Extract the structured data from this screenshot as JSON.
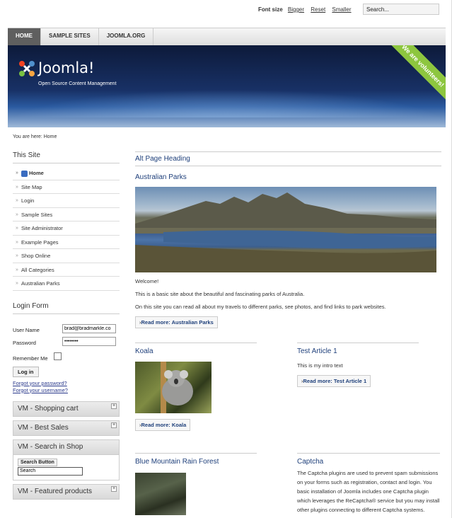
{
  "top": {
    "font_size_label": "Font size",
    "bigger": "Bigger",
    "reset": "Reset",
    "smaller": "Smaller",
    "search_value": "Search..."
  },
  "nav": {
    "items": [
      {
        "label": "HOME",
        "active": true
      },
      {
        "label": "SAMPLE SITES",
        "active": false
      },
      {
        "label": "JOOMLA.ORG",
        "active": false
      }
    ]
  },
  "header": {
    "logo_text": "Joomla!",
    "tagline": "Open Source Content Management",
    "banner": "We are volunteers!"
  },
  "breadcrumb": "You are here: Home",
  "sidebar": {
    "this_site_title": "This Site",
    "menu": [
      {
        "label": "Home"
      },
      {
        "label": "Site Map"
      },
      {
        "label": "Login"
      },
      {
        "label": "Sample Sites"
      },
      {
        "label": "Site Administrator"
      },
      {
        "label": "Example Pages"
      },
      {
        "label": "Shop Online"
      },
      {
        "label": "All Categories"
      },
      {
        "label": "Australian Parks"
      }
    ],
    "login": {
      "title": "Login Form",
      "user_label": "User Name",
      "user_value": "brad@bradmarkle.co",
      "password_label": "Password",
      "password_value": "••••••••",
      "remember_label": "Remember Me",
      "login_button": "Log in",
      "forgot_password": "Forgot your password?",
      "forgot_username": "Forgot your username?"
    },
    "vm": {
      "cart": "VM - Shopping cart",
      "best": "VM - Best Sales",
      "search": "VM - Search in Shop",
      "search_button": "Search Button",
      "search_value": "Search",
      "featured": "VM - Featured products",
      "plus": "+"
    }
  },
  "main": {
    "alt_heading": "Alt Page Heading",
    "article_title": "Australian Parks",
    "p1": "Welcome!",
    "p2": "This is a basic site about the beautiful and fascinating parks of Australia.",
    "p3": "On this site you can read all about my travels to different parks, see photos, and find links to park websites.",
    "readmore_parks": "Read more: Australian Parks",
    "koala_title": "Koala",
    "readmore_koala": "Read more: Koala",
    "test_title": "Test Article 1",
    "test_text": "This is my intro text",
    "readmore_test": "Read more: Test Article 1",
    "forest_title": "Blue Mountain Rain Forest",
    "captcha_title": "Captcha",
    "captcha_text": "The Captcha plugins are used to prevent spam submissions on your forms such as registration, contact and login. You basic installation of Joomla includes one Captcha plugin which leverages the ReCaptcha® service but you may install other plugins connecting to different Captcha systems."
  }
}
